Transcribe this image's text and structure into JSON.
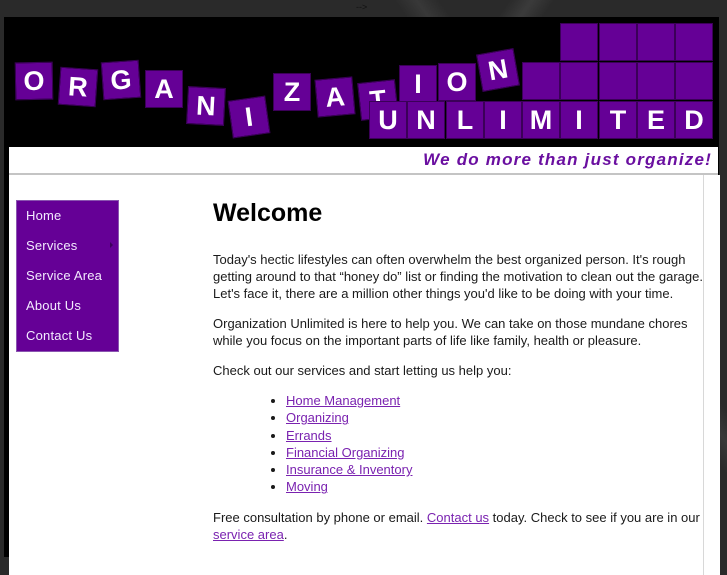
{
  "stray_text": "-->",
  "header": {
    "logo_word1": [
      "O",
      "R",
      "G",
      "A",
      "N",
      "I",
      "Z",
      "A",
      "T",
      "I",
      "O",
      "N"
    ],
    "logo_word2": [
      "U",
      "N",
      "L",
      "I",
      "M",
      "I",
      "T",
      "E",
      "D"
    ],
    "tagline": "We do more than just organize!"
  },
  "nav": {
    "items": [
      {
        "label": "Home",
        "has_submenu": false
      },
      {
        "label": "Services",
        "has_submenu": true
      },
      {
        "label": "Service Area",
        "has_submenu": false
      },
      {
        "label": "About Us",
        "has_submenu": false
      },
      {
        "label": "Contact Us",
        "has_submenu": false
      }
    ]
  },
  "main": {
    "title": "Welcome",
    "para1": "Today's hectic lifestyles can often overwhelm the best organized person. It's rough getting around to that “honey do” list or finding the motivation to clean out the garage. Let's face it, there are a million other things you'd like to be doing with your time.",
    "para2": "Organization Unlimited is here to help you. We can take on those mundane chores while you focus on the important parts of life like family, health or pleasure.",
    "para3": "Check out our services and start letting us help you:",
    "services": [
      "Home Management",
      "Organizing",
      "Errands",
      "Financial Organizing",
      "Insurance & Inventory",
      "Moving"
    ],
    "para4_before": "Free consultation by phone or email. ",
    "para4_link1": "Contact us",
    "para4_middle": " today. Check to see if you are in our ",
    "para4_link2": "service area",
    "para4_after": "."
  },
  "colors": {
    "brand_purple": "#650096",
    "link_purple": "#7a22b0",
    "tagline_purple": "#6a0fa0"
  }
}
